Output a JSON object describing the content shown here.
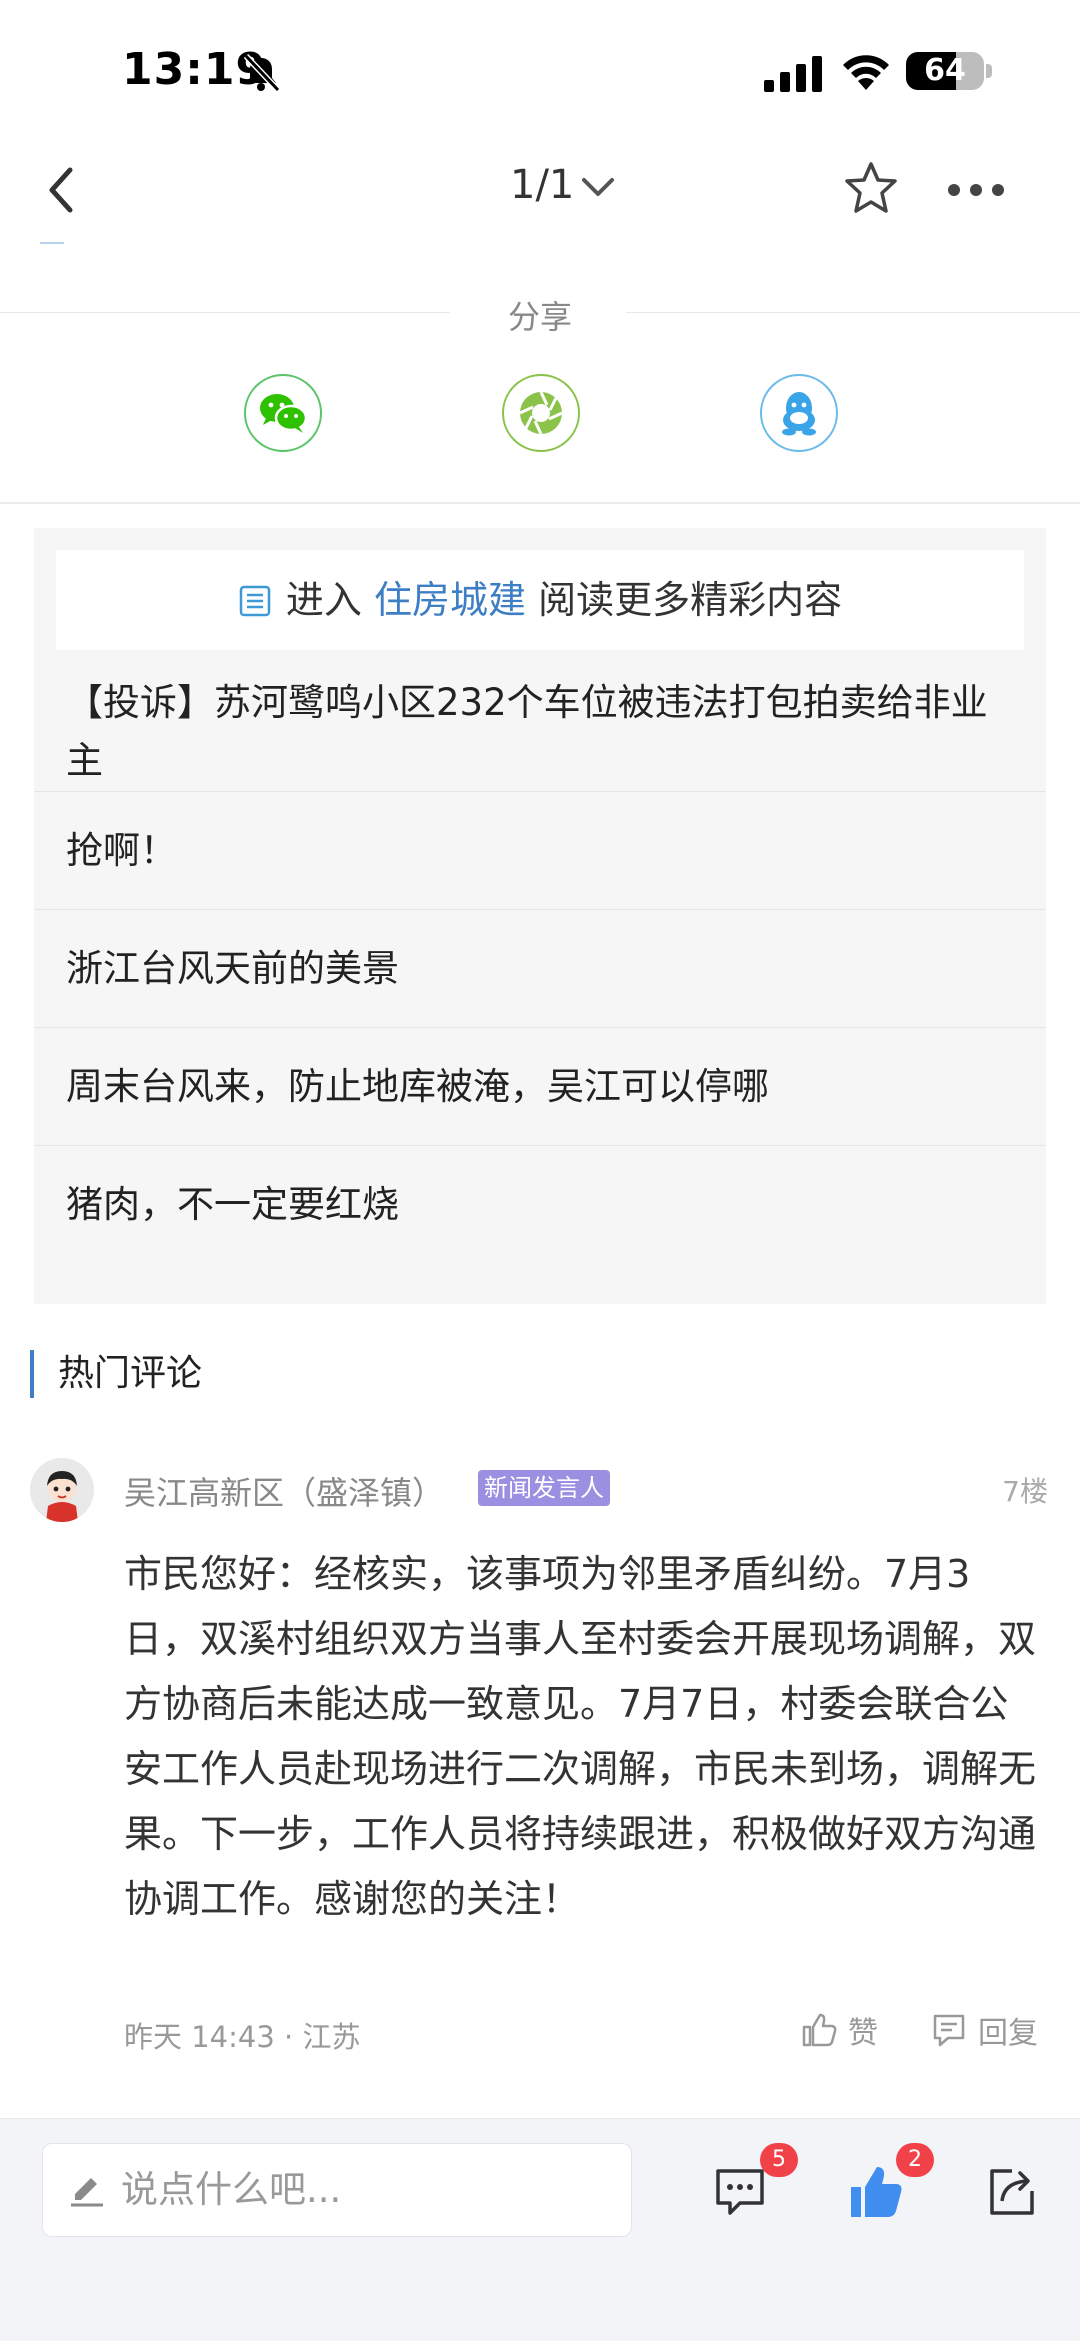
{
  "status_bar": {
    "time": "13:19",
    "battery": "64",
    "battery_level": 0.64
  },
  "nav": {
    "page_indicator": "1/1"
  },
  "share": {
    "title": "分享",
    "targets": [
      "wechat",
      "moments",
      "qq"
    ]
  },
  "related": {
    "enter_prefix": "进入",
    "channel": "住房城建",
    "enter_suffix": "阅读更多精彩内容",
    "items": [
      "【投诉】苏河鹭鸣小区232个车位被违法打包拍卖给非业主",
      "抢啊！",
      "浙江台风天前的美景",
      "周末台风来，防止地库被淹，吴江可以停哪",
      "猪肉，不一定要红烧"
    ]
  },
  "hot_comments": {
    "title": "热门评论",
    "comment": {
      "author": "吴江高新区（盛泽镇）",
      "badge": "新闻发言人",
      "floor": "7楼",
      "body": "市民您好：经核实，该事项为邻里矛盾纠纷。7月3日，双溪村组织双方当事人至村委会开展现场调解，双方协商后未能达成一致意见。7月7日，村委会联合公安工作人员赴现场进行二次调解，市民未到场，调解无果。下一步，工作人员将持续跟进，积极做好双方沟通协调工作。感谢您的关注！",
      "meta": "昨天 14:43 · 江苏",
      "like_label": "赞",
      "reply_label": "回复"
    }
  },
  "bottom_bar": {
    "input_placeholder": "说点什么吧...",
    "comments_count": "5",
    "likes_count": "2"
  },
  "colors": {
    "accent": "#3e7ec5",
    "badge_red": "#f1424a",
    "wechat_green": "#2dc100",
    "moments_green": "#8bc34a",
    "qq_blue": "#3aa4e8"
  }
}
